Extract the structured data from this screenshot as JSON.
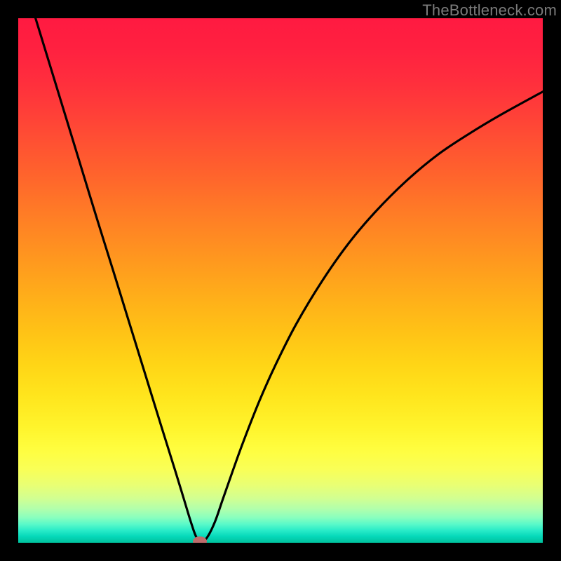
{
  "watermark": "TheBottleneck.com",
  "colors": {
    "border": "#000000",
    "gradient_stops": [
      {
        "offset": 0.0,
        "color": "#ff1a41"
      },
      {
        "offset": 0.06,
        "color": "#ff2140"
      },
      {
        "offset": 0.12,
        "color": "#ff2e3d"
      },
      {
        "offset": 0.18,
        "color": "#ff3f38"
      },
      {
        "offset": 0.24,
        "color": "#ff5232"
      },
      {
        "offset": 0.3,
        "color": "#ff642c"
      },
      {
        "offset": 0.36,
        "color": "#ff7827"
      },
      {
        "offset": 0.42,
        "color": "#ff8b22"
      },
      {
        "offset": 0.48,
        "color": "#ff9e1d"
      },
      {
        "offset": 0.54,
        "color": "#ffb119"
      },
      {
        "offset": 0.6,
        "color": "#ffc316"
      },
      {
        "offset": 0.66,
        "color": "#ffd516"
      },
      {
        "offset": 0.72,
        "color": "#ffe51d"
      },
      {
        "offset": 0.78,
        "color": "#fff42c"
      },
      {
        "offset": 0.82,
        "color": "#fffd3e"
      },
      {
        "offset": 0.86,
        "color": "#f9ff57"
      },
      {
        "offset": 0.89,
        "color": "#e9ff74"
      },
      {
        "offset": 0.915,
        "color": "#d2ff91"
      },
      {
        "offset": 0.935,
        "color": "#b2ffab"
      },
      {
        "offset": 0.952,
        "color": "#89ffbe"
      },
      {
        "offset": 0.965,
        "color": "#58f9c9"
      },
      {
        "offset": 0.977,
        "color": "#27ebc8"
      },
      {
        "offset": 0.988,
        "color": "#05d8b9"
      },
      {
        "offset": 1.0,
        "color": "#00c29d"
      }
    ],
    "curve": "#000000",
    "marker": "#be6c6c"
  },
  "chart_data": {
    "type": "line",
    "title": "",
    "xlabel": "",
    "ylabel": "",
    "xlim": [
      0,
      100
    ],
    "ylim": [
      0,
      100
    ],
    "grid": false,
    "x": [
      3.3,
      6,
      9,
      12,
      15,
      18,
      21,
      24,
      27,
      30,
      31.5,
      33,
      34,
      35,
      36,
      37.5,
      39,
      41,
      43,
      46,
      49,
      53,
      58,
      63,
      68,
      74,
      80,
      86,
      92,
      100
    ],
    "y": [
      100,
      91.2,
      81.4,
      71.6,
      61.8,
      52.2,
      42.5,
      32.8,
      23.1,
      13.5,
      8.6,
      3.7,
      1.0,
      0.3,
      1.0,
      4.0,
      8.3,
      14.0,
      19.5,
      27.1,
      33.8,
      41.7,
      50.0,
      57.1,
      63.0,
      69.0,
      74.0,
      78.0,
      81.6,
      86.0
    ],
    "marker": {
      "x": 34.6,
      "y": 0.3
    },
    "note": "Bottleneck-style V-curve chart over a traffic-light gradient. Values estimated from pixel positions (no axis ticks rendered)."
  }
}
